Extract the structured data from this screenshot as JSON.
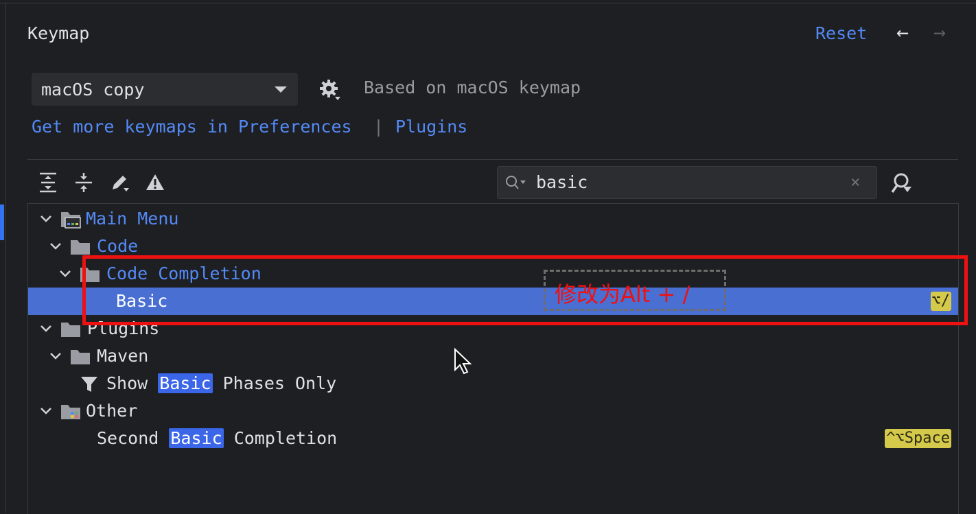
{
  "header": {
    "title": "Keymap",
    "reset_label": "Reset",
    "back_icon": "arrow-left-icon",
    "forward_icon": "arrow-right-icon"
  },
  "keymap": {
    "selected": "macOS copy",
    "based_on": "Based on macOS keymap"
  },
  "links": {
    "get_more": "Get more keymaps in Preferences",
    "separator": "|",
    "plugins": "Plugins"
  },
  "toolbar": {
    "icons": [
      "expand-all-icon",
      "collapse-all-icon",
      "edit-shortcut-icon",
      "conflicts-warning-icon"
    ]
  },
  "search": {
    "value": "basic",
    "clear_icon": "×"
  },
  "tree": {
    "main_menu": "Main Menu",
    "code": "Code",
    "code_completion": "Code Completion",
    "basic": "Basic",
    "basic_shortcut": "⌥/",
    "plugins": "Plugins",
    "maven": "Maven",
    "show_basic": {
      "before": "Show",
      "match": "Basic",
      "after": "Phases Only"
    },
    "other": "Other",
    "second_basic": {
      "before": "Second",
      "match": "Basic",
      "after": "Completion"
    },
    "second_basic_shortcut": "^⌥Space"
  },
  "annotation": {
    "text": "修改为Alt + /",
    "color": "#ee1111"
  },
  "colors": {
    "background": "#1e1f22",
    "accent": "#548af7",
    "selection": "#4a6fd3",
    "shortcut_badge": "#d4c94b"
  }
}
